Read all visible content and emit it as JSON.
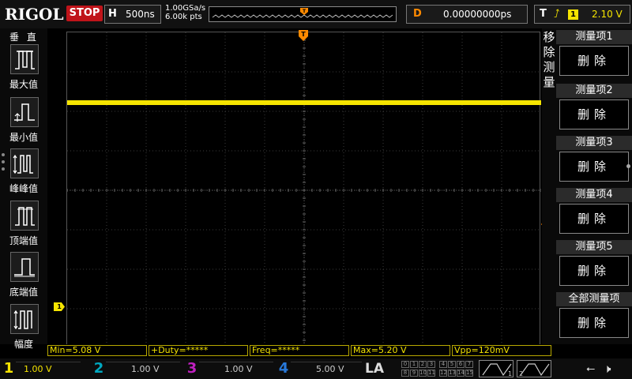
{
  "top": {
    "logo": "RIGOL",
    "run_state": "STOP",
    "h_label": "H",
    "timebase": "500ns",
    "sample_rate": "1.00GSa/s",
    "mem_depth": "6.00k pts",
    "delay_label": "D",
    "delay_value": "0.00000000ps",
    "trig_label": "T",
    "trig_source": "1",
    "trig_level": "2.10 V"
  },
  "left_panel": {
    "title": "垂 直",
    "items": [
      {
        "label": "最大值",
        "icon": "max-pulse-icon"
      },
      {
        "label": "最小值",
        "icon": "min-pulse-icon"
      },
      {
        "label": "峰峰值",
        "icon": "peak-peak-pulse-icon"
      },
      {
        "label": "顶端值",
        "icon": "top-pulse-icon"
      },
      {
        "label": "底端值",
        "icon": "base-pulse-icon"
      },
      {
        "label": "幅度",
        "icon": "amplitude-pulse-icon"
      }
    ]
  },
  "right_menu": {
    "title_vertical": "移除测量",
    "items": [
      {
        "title": "测量项1",
        "action": "删除"
      },
      {
        "title": "测量项2",
        "action": "删除"
      },
      {
        "title": "测量项3",
        "action": "删除"
      },
      {
        "title": "测量项4",
        "action": "删除"
      },
      {
        "title": "测量项5",
        "action": "删除"
      },
      {
        "title": "全部测量项",
        "action": "删除"
      }
    ]
  },
  "measurements": [
    {
      "text": "Min=5.08 V"
    },
    {
      "text": "+Duty=*****"
    },
    {
      "text": "Freq=*****"
    },
    {
      "text": "Max=5.20 V"
    },
    {
      "text": "Vpp=120mV"
    }
  ],
  "markers": {
    "ch1": "1",
    "trig_pos": "T"
  },
  "channels": [
    {
      "num": "1",
      "scale": "1.00 V",
      "color": "#f5e400"
    },
    {
      "num": "2",
      "scale": "1.00 V",
      "color": "#00c8e8"
    },
    {
      "num": "3",
      "scale": "1.00 V",
      "color": "#e020d8"
    },
    {
      "num": "4",
      "scale": "5.00 V",
      "color": "#1e90ff"
    }
  ],
  "la_label": "LA",
  "la_digits": [
    "0",
    "1",
    "2",
    "3",
    "4",
    "5",
    "6",
    "7",
    "8",
    "9",
    "10",
    "11",
    "12",
    "13",
    "14",
    "15"
  ],
  "colors": {
    "trace": "#f5e400",
    "stop": "#c0141a",
    "delay": "#ff8a00"
  }
}
